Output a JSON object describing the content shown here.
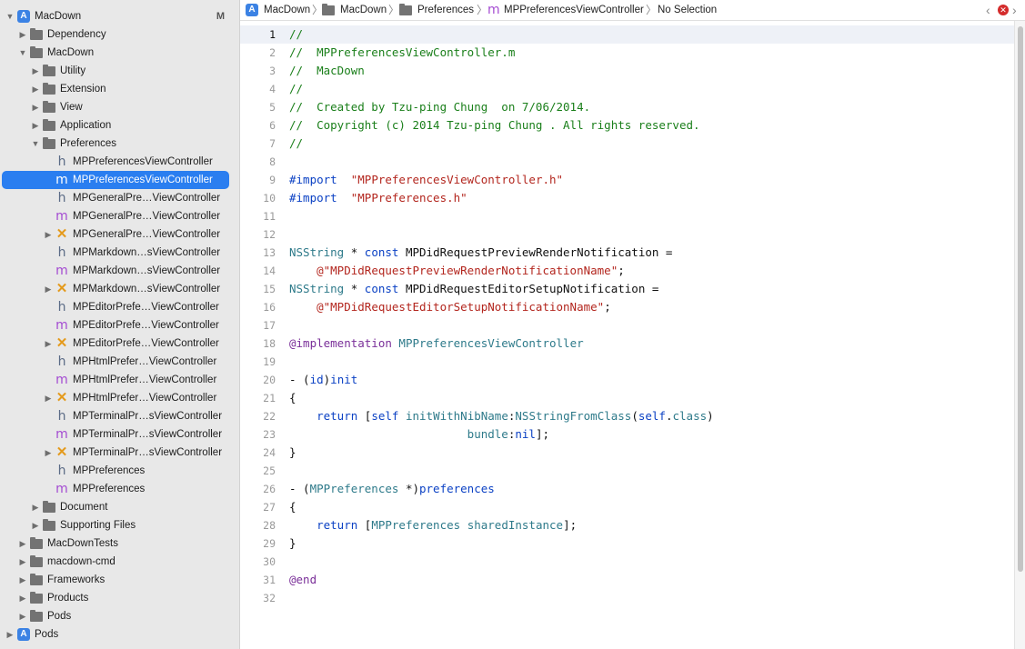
{
  "navigator": {
    "project_badge": "M",
    "items": [
      {
        "label": "MacDown",
        "kind": "project",
        "disc": "▼"
      },
      {
        "label": "Dependency",
        "kind": "folder",
        "disc": "▶"
      },
      {
        "label": "MacDown",
        "kind": "folder",
        "disc": "▼"
      },
      {
        "label": "Utility",
        "kind": "folder",
        "disc": "▶"
      },
      {
        "label": "Extension",
        "kind": "folder",
        "disc": "▶"
      },
      {
        "label": "View",
        "kind": "folder",
        "disc": "▶"
      },
      {
        "label": "Application",
        "kind": "folder",
        "disc": "▶"
      },
      {
        "label": "Preferences",
        "kind": "folder",
        "disc": "▼"
      },
      {
        "label": "MPPreferencesViewController",
        "kind": "h"
      },
      {
        "label": "MPPreferencesViewController",
        "kind": "m",
        "selected": true
      },
      {
        "label": "MPGeneralPre…ViewController",
        "kind": "h"
      },
      {
        "label": "MPGeneralPre…ViewController",
        "kind": "m"
      },
      {
        "label": "MPGeneralPre…ViewController",
        "kind": "xib",
        "disc": "▶"
      },
      {
        "label": "MPMarkdown…sViewController",
        "kind": "h"
      },
      {
        "label": "MPMarkdown…sViewController",
        "kind": "m"
      },
      {
        "label": "MPMarkdown…sViewController",
        "kind": "xib",
        "disc": "▶"
      },
      {
        "label": "MPEditorPrefe…ViewController",
        "kind": "h"
      },
      {
        "label": "MPEditorPrefe…ViewController",
        "kind": "m"
      },
      {
        "label": "MPEditorPrefe…ViewController",
        "kind": "xib",
        "disc": "▶"
      },
      {
        "label": "MPHtmlPrefer…ViewController",
        "kind": "h"
      },
      {
        "label": "MPHtmlPrefer…ViewController",
        "kind": "m"
      },
      {
        "label": "MPHtmlPrefer…ViewController",
        "kind": "xib",
        "disc": "▶"
      },
      {
        "label": "MPTerminalPr…sViewController",
        "kind": "h"
      },
      {
        "label": "MPTerminalPr…sViewController",
        "kind": "m"
      },
      {
        "label": "MPTerminalPr…sViewController",
        "kind": "xib",
        "disc": "▶"
      },
      {
        "label": "MPPreferences",
        "kind": "h"
      },
      {
        "label": "MPPreferences",
        "kind": "m"
      },
      {
        "label": "Document",
        "kind": "folder",
        "disc": "▶"
      },
      {
        "label": "Supporting Files",
        "kind": "folder",
        "disc": "▶"
      },
      {
        "label": "MacDownTests",
        "kind": "folder",
        "disc": "▶"
      },
      {
        "label": "macdown-cmd",
        "kind": "folder",
        "disc": "▶"
      },
      {
        "label": "Frameworks",
        "kind": "folder",
        "disc": "▶"
      },
      {
        "label": "Products",
        "kind": "folder",
        "disc": "▶"
      },
      {
        "label": "Pods",
        "kind": "folder",
        "disc": "▶"
      },
      {
        "label": "Pods",
        "kind": "project",
        "disc": "▶"
      }
    ]
  },
  "jumpbar": {
    "crumbs": [
      "MacDown",
      "MacDown",
      "Preferences",
      "MPPreferencesViewController",
      "No Selection"
    ]
  },
  "editor": {
    "current_line": 1,
    "lines": [
      [
        [
          "c",
          "//"
        ]
      ],
      [
        [
          "c",
          "//  MPPreferencesViewController.m"
        ]
      ],
      [
        [
          "c",
          "//  MacDown"
        ]
      ],
      [
        [
          "c",
          "//"
        ]
      ],
      [
        [
          "c",
          "//  Created by Tzu-ping Chung  on 7/06/2014."
        ]
      ],
      [
        [
          "c",
          "//  Copyright (c) 2014 Tzu-ping Chung . All rights reserved."
        ]
      ],
      [
        [
          "c",
          "//"
        ]
      ],
      [],
      [
        [
          "k",
          "#import"
        ],
        [
          "",
          "  "
        ],
        [
          "s",
          "\"MPPreferencesViewController.h\""
        ]
      ],
      [
        [
          "k",
          "#import"
        ],
        [
          "",
          "  "
        ],
        [
          "s",
          "\"MPPreferences.h\""
        ]
      ],
      [],
      [],
      [
        [
          "t",
          "NSString"
        ],
        [
          "",
          " * "
        ],
        [
          "k",
          "const"
        ],
        [
          "",
          " MPDidRequestPreviewRenderNotification ="
        ]
      ],
      [
        [
          "",
          "    "
        ],
        [
          "s",
          "@\"MPDidRequestPreviewRenderNotificationName\""
        ],
        [
          "",
          ";"
        ]
      ],
      [
        [
          "t",
          "NSString"
        ],
        [
          "",
          " * "
        ],
        [
          "k",
          "const"
        ],
        [
          "",
          " MPDidRequestEditorSetupNotification ="
        ]
      ],
      [
        [
          "",
          "    "
        ],
        [
          "s",
          "@\"MPDidRequestEditorSetupNotificationName\""
        ],
        [
          "",
          ";"
        ]
      ],
      [],
      [
        [
          "d",
          "@implementation"
        ],
        [
          "",
          " "
        ],
        [
          "t",
          "MPPreferencesViewController"
        ]
      ],
      [],
      [
        [
          "",
          "- ("
        ],
        [
          "k",
          "id"
        ],
        [
          "",
          ")"
        ],
        [
          "m",
          "init"
        ]
      ],
      [
        [
          "",
          "{"
        ]
      ],
      [
        [
          "",
          "    "
        ],
        [
          "k",
          "return"
        ],
        [
          "",
          " ["
        ],
        [
          "k",
          "self"
        ],
        [
          "",
          " "
        ],
        [
          "f",
          "initWithNibName"
        ],
        [
          "",
          ":"
        ],
        [
          "f",
          "NSStringFromClass"
        ],
        [
          "",
          "("
        ],
        [
          "k",
          "self"
        ],
        [
          "",
          "."
        ],
        [
          "f",
          "class"
        ],
        [
          "",
          ")"
        ]
      ],
      [
        [
          "",
          "                          "
        ],
        [
          "f",
          "bundle"
        ],
        [
          "",
          ":"
        ],
        [
          "k",
          "nil"
        ],
        [
          "",
          "];"
        ]
      ],
      [
        [
          "",
          "}"
        ]
      ],
      [],
      [
        [
          "",
          "- ("
        ],
        [
          "t",
          "MPPreferences"
        ],
        [
          "",
          " *)"
        ],
        [
          "m",
          "preferences"
        ]
      ],
      [
        [
          "",
          "{"
        ]
      ],
      [
        [
          "",
          "    "
        ],
        [
          "k",
          "return"
        ],
        [
          "",
          " ["
        ],
        [
          "t",
          "MPPreferences"
        ],
        [
          "",
          " "
        ],
        [
          "f",
          "sharedInstance"
        ],
        [
          "",
          "];"
        ]
      ],
      [
        [
          "",
          "}"
        ]
      ],
      [],
      [
        [
          "d",
          "@end"
        ]
      ],
      []
    ]
  },
  "colors": {
    "selection": "#2a7ef0",
    "comment": "#1a7f1a",
    "string": "#b3261e",
    "keyword": "#0b41c4",
    "type": "#2e7a8a"
  }
}
